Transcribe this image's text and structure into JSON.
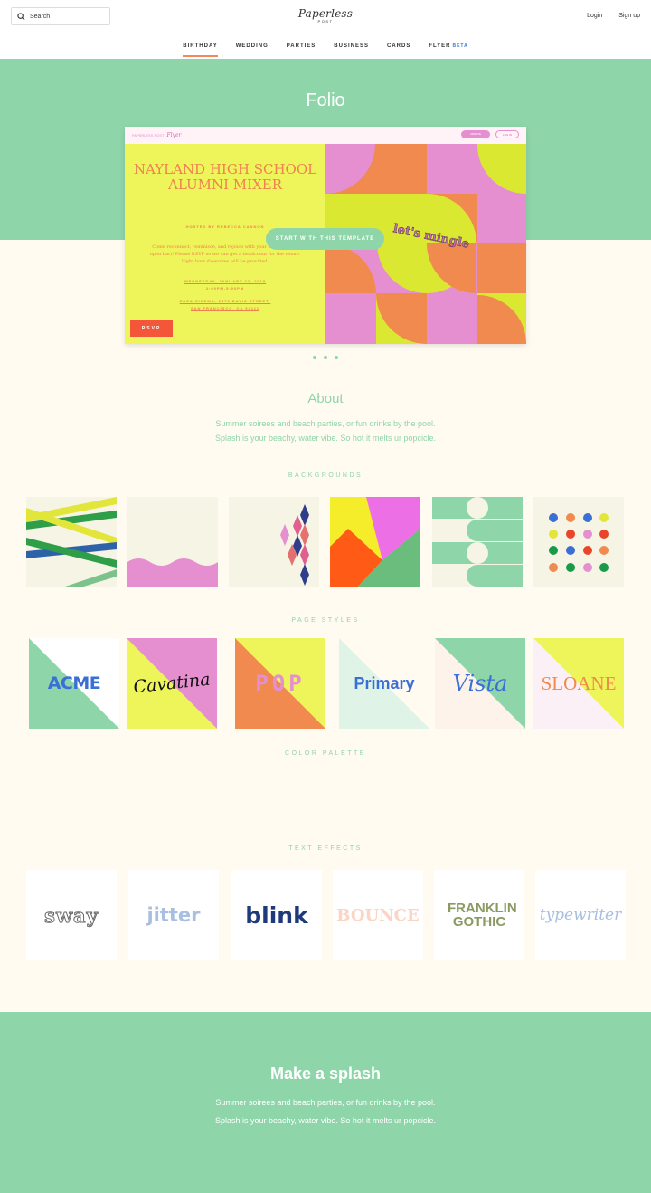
{
  "header": {
    "search_placeholder": "Search",
    "logo_main": "Paperless",
    "logo_sub": "POST",
    "login": "Login",
    "signup": "Sign up"
  },
  "nav": {
    "items": [
      {
        "label": "BIRTHDAY",
        "active": true
      },
      {
        "label": "WEDDING"
      },
      {
        "label": "PARTIES"
      },
      {
        "label": "BUSINESS"
      },
      {
        "label": "CARDS"
      },
      {
        "label": "FLYER",
        "badge": "BETA"
      }
    ]
  },
  "hero": {
    "title": "Folio",
    "start_button": "START WITH THIS TEMPLATE"
  },
  "preview": {
    "brand": "PAPERLESS POST",
    "brand_product": "Flyer",
    "top_btn1": "CREATE",
    "top_btn2": "LOG IN",
    "title": "NAYLAND HIGH SCHOOL ALUMNI MIXER",
    "host": "HOSTED BY REBECCA CANNON",
    "body": "Come reconnect, reminisce, and rejoice with your class (and an open bar)! Please RSVP so we can get a headcount for the venue. Light hors d'oeuvres will be provided.",
    "when_line1": "WEDNESDAY, JANUARY 22, 2019",
    "when_line2": "2:00PM-5:00PM",
    "where_line1": "ZOEA CINEMA, 2476 DAVIS STREET,",
    "where_line2": "SAN FRANCISCO, CA 94111",
    "rsvp": "RSVP",
    "stamp": "let's mingle"
  },
  "about": {
    "title": "About",
    "line1": "Summer soirees and beach parties, or fun drinks by the pool.",
    "line2": "Splash is your beachy, water vibe. So hot it melts ur popcicle."
  },
  "sections": {
    "backgrounds": "BACKGROUNDS",
    "page_styles": "PAGE STYLES",
    "color_palette": "COLOR PALETTE",
    "text_effects": "TEXT EFFECTS"
  },
  "page_styles": [
    "ACME",
    "Cavatina",
    "POP",
    "Primary",
    "Vista",
    "SLOANE"
  ],
  "text_effects": [
    "sway",
    "jitter",
    "blink",
    "BOUNCE",
    "FRANKLIN GOTHIC",
    "typewriter"
  ],
  "footer": {
    "title": "Make a splash",
    "line1": "Summer soirees and beach parties, or fun drinks by the pool.",
    "line2": "Splash is your beachy, water vibe. So hot it melts ur popcicle."
  },
  "colors": {
    "mint": "#8fd5aa",
    "cream": "#fffbf1",
    "coral": "#f08a5c",
    "yellow": "#eef55a",
    "pink": "#e58fd0"
  }
}
